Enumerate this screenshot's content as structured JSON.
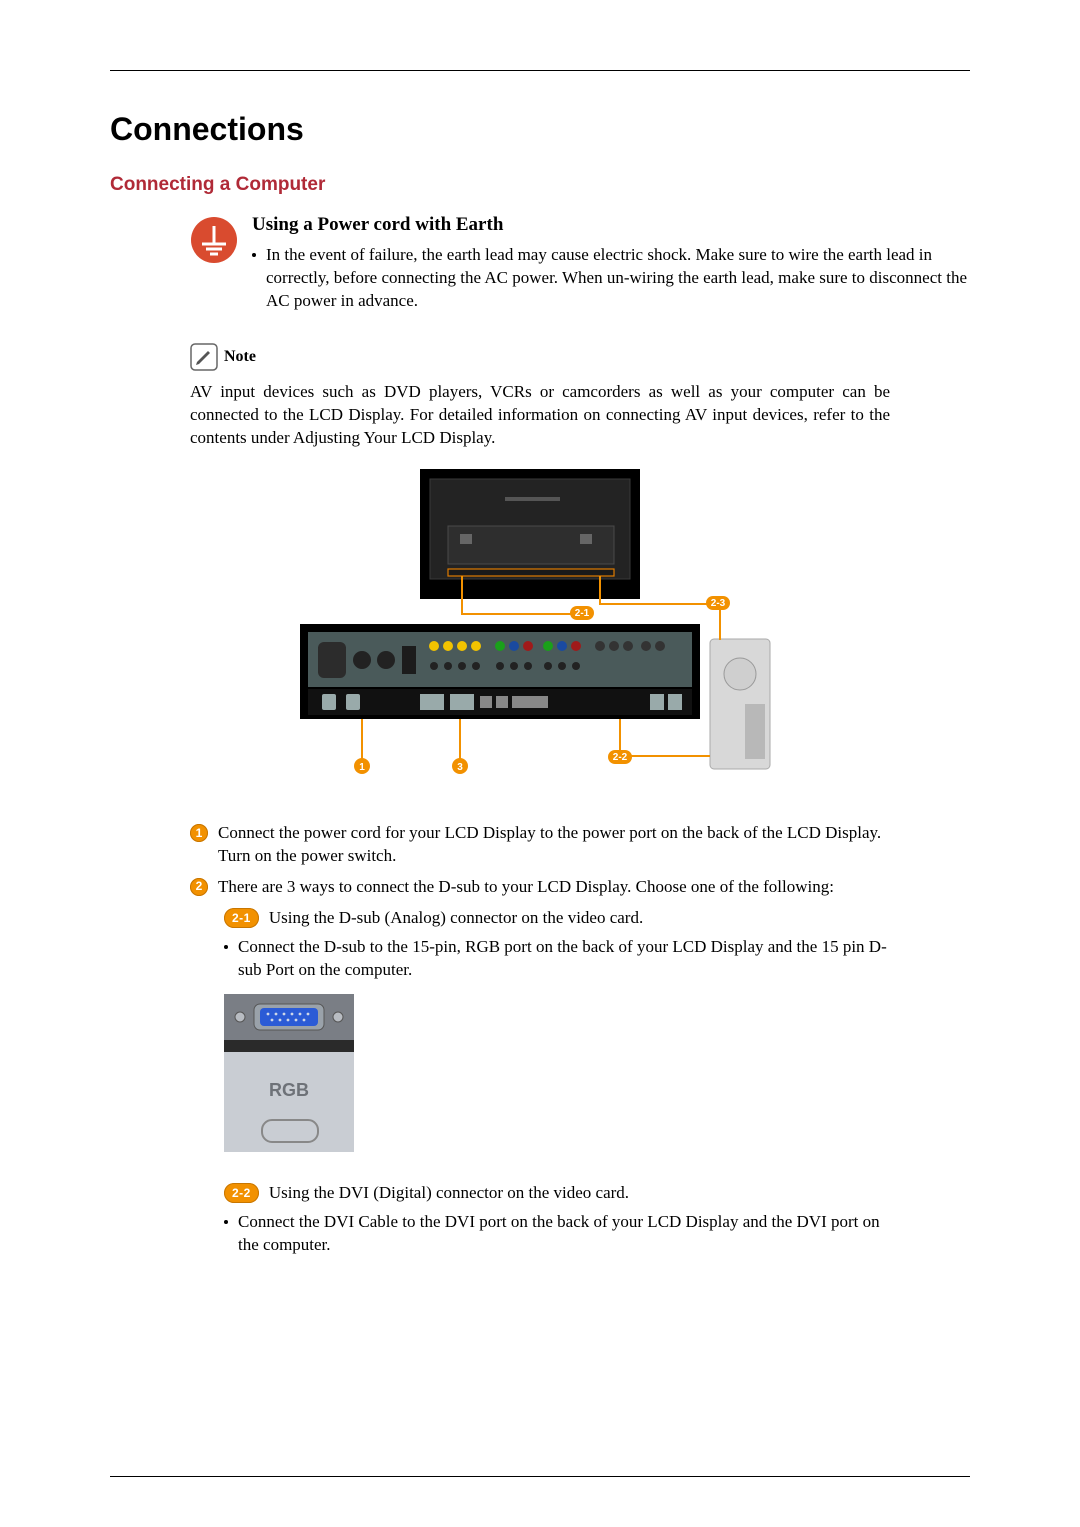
{
  "title": "Connections",
  "subtitle": "Connecting a Computer",
  "earth": {
    "heading": "Using a Power cord with Earth",
    "body": "In the event of failure, the earth lead may cause electric shock. Make sure to wire the earth lead in correctly, before connecting the AC power. When un-wiring the earth lead, make sure to disconnect the AC power in advance."
  },
  "note": {
    "label": "Note",
    "body": "AV input devices such as DVD players, VCRs or camcorders as well as your computer can be connected to the LCD Display. For detailed information on connecting AV input devices, refer to the contents under Adjusting Your LCD Display."
  },
  "diagram": {
    "callouts": [
      "1",
      "2-1",
      "2-2",
      "2-3",
      "3"
    ]
  },
  "steps": {
    "one": {
      "marker": "1",
      "text": "Connect the power cord for your LCD Display to the power port on the back of the LCD Display. Turn on the power switch."
    },
    "two": {
      "marker": "2",
      "text": "There are 3 ways to connect the D-sub to your LCD Display. Choose one of the following:"
    },
    "two_one": {
      "marker": "2-1",
      "text": "Using the D-sub (Analog) connector on the video card.",
      "bullet": "Connect the D-sub to the 15-pin, RGB port on the back of your LCD Display and the 15 pin D-sub Port on the computer."
    },
    "two_two": {
      "marker": "2-2",
      "text": "Using the DVI (Digital) connector on the video card.",
      "bullet": "Connect the DVI Cable to the DVI port on the back of your LCD Display and the DVI port on the computer."
    }
  },
  "rgb_label": "RGB"
}
